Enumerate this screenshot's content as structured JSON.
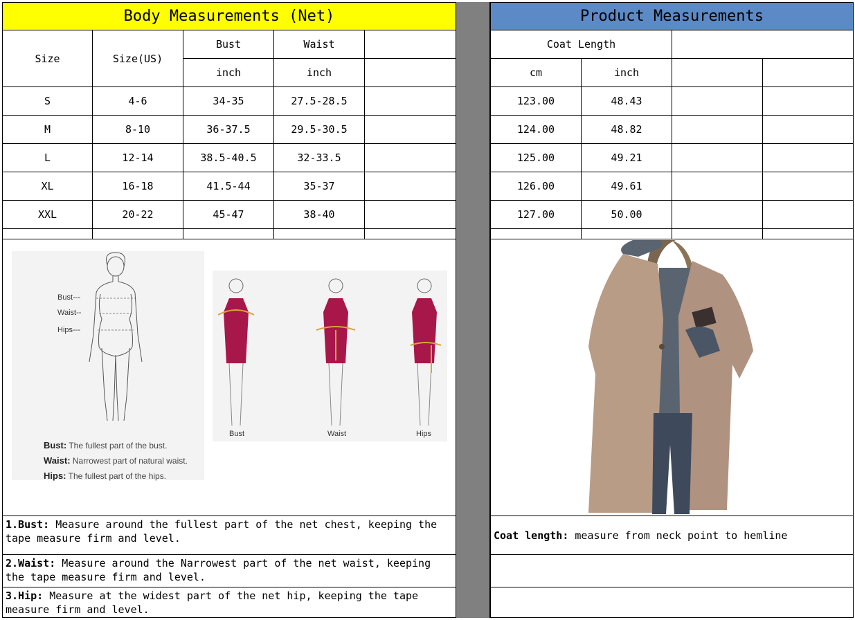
{
  "left": {
    "title": "Body Measurements (Net)",
    "headers": {
      "size": "Size",
      "size_us": "Size(US)",
      "bust": "Bust",
      "waist": "Waist",
      "bust_unit": "inch",
      "waist_unit": "inch"
    },
    "rows": [
      {
        "size": "S",
        "us": "4-6",
        "bust": "34-35",
        "waist": "27.5-28.5"
      },
      {
        "size": "M",
        "us": "8-10",
        "bust": "36-37.5",
        "waist": "29.5-30.5"
      },
      {
        "size": "L",
        "us": "12-14",
        "bust": "38.5-40.5",
        "waist": "32-33.5"
      },
      {
        "size": "XL",
        "us": "16-18",
        "bust": "41.5-44",
        "waist": "35-37"
      },
      {
        "size": "XXL",
        "us": "20-22",
        "bust": "45-47",
        "waist": "38-40"
      }
    ],
    "figure": {
      "labels": {
        "bust": "Bust---",
        "waist": "Waist--",
        "hips": "Hips---"
      },
      "defs": [
        {
          "term": "Bust:",
          "text": "The fullest part of the bust."
        },
        {
          "term": "Waist:",
          "text": "Narrowest part of natural waist."
        },
        {
          "term": "Hips:",
          "text": "The fullest part of the hips."
        }
      ],
      "captions": [
        "Bust",
        "Waist",
        "Hips"
      ]
    },
    "notes": [
      {
        "term": "1.Bust:",
        "text": "  Measure around the fullest part of the net chest, keeping the tape  measure firm and level."
      },
      {
        "term": "2.Waist:",
        "text": " Measure around the Narrowest part of the net waist, keeping the tape  measure firm and level."
      },
      {
        "term": "3.Hip:",
        "text": " Measure at the widest part of the net hip, keeping the tape measure firm and level."
      }
    ]
  },
  "right": {
    "title": "Product Measurements",
    "header": "Coat Length",
    "units": {
      "cm": "cm",
      "inch": "inch"
    },
    "rows": [
      {
        "cm": "123.00",
        "inch": "48.43"
      },
      {
        "cm": "124.00",
        "inch": "48.82"
      },
      {
        "cm": "125.00",
        "inch": "49.21"
      },
      {
        "cm": "126.00",
        "inch": "49.61"
      },
      {
        "cm": "127.00",
        "inch": "50.00"
      }
    ],
    "note": {
      "term": "Coat length:",
      "text": " measure from neck point to hemline"
    }
  },
  "colors": {
    "left_header": "#ffff00",
    "right_header": "#5b8ac7",
    "separator": "#808080",
    "dress": "#a8174a",
    "coat": "#b89c86"
  }
}
